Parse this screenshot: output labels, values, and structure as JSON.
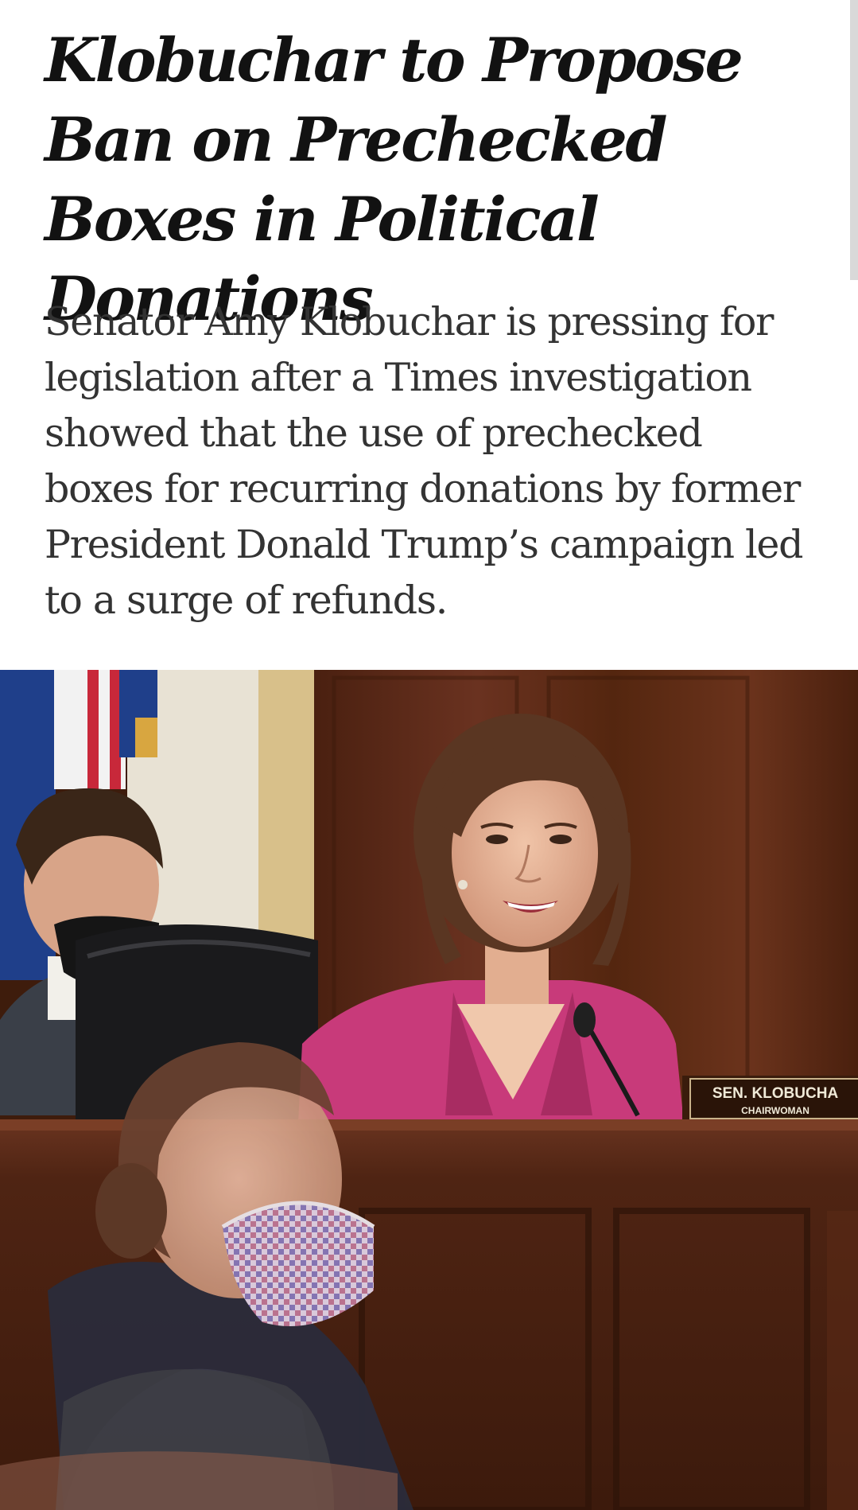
{
  "article": {
    "headline": "Klobuchar to Propose Ban on Prechecked Boxes in Political Donations",
    "summary": "Senator Amy Klobuchar is pressing for legislation after a Times investigation showed that the use of prechecked boxes for recurring donations by former President Donald Trump’s campaign led to a surge of refunds."
  },
  "photo": {
    "nameplate_name": "SEN. KLOBUCHA",
    "nameplate_title": "CHAIRWOMAN",
    "colors": {
      "wood_panel": "#5a2a16",
      "desk": "#4e2412",
      "jacket": "#c83a7a",
      "flag_blue": "#1f3f8a",
      "flag_red": "#c8283a"
    }
  }
}
